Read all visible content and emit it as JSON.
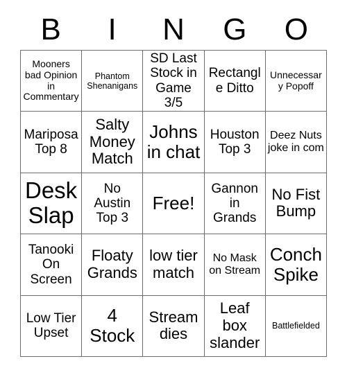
{
  "header": {
    "letters": [
      "B",
      "I",
      "N",
      "G",
      "O"
    ]
  },
  "grid": {
    "rows": 5,
    "columns": 5,
    "border_color": "#6e6e6e",
    "background": "#ffffff",
    "text_color": "#000000"
  },
  "cells": [
    {
      "text": "Mooners bad Opinion in Commentary",
      "size": "fs-xs"
    },
    {
      "text": "Phantom Shenanigans",
      "size": "fs-xxs"
    },
    {
      "text": "SD Last Stock in Game 3/5",
      "size": "fs-m"
    },
    {
      "text": "Rectangle Ditto",
      "size": "fs-m"
    },
    {
      "text": "Unnecessary Popoff",
      "size": "fs-xs"
    },
    {
      "text": "Mariposa Top 8",
      "size": "fs-m"
    },
    {
      "text": "Salty Money Match",
      "size": "fs-l"
    },
    {
      "text": "Johns in chat",
      "size": "fs-xl"
    },
    {
      "text": "Houston Top 3",
      "size": "fs-m"
    },
    {
      "text": "Deez Nuts joke in com",
      "size": "fs-s"
    },
    {
      "text": "Desk Slap",
      "size": "fs-xxl"
    },
    {
      "text": "No Austin Top 3",
      "size": "fs-m"
    },
    {
      "text": "Free!",
      "size": "fs-xl"
    },
    {
      "text": "Gannon in Grands",
      "size": "fs-m"
    },
    {
      "text": "No Fist Bump",
      "size": "fs-l"
    },
    {
      "text": "Tanooki On Screen",
      "size": "fs-m"
    },
    {
      "text": "Floaty Grands",
      "size": "fs-l"
    },
    {
      "text": "low tier match",
      "size": "fs-l"
    },
    {
      "text": "No Mask on Stream",
      "size": "fs-s"
    },
    {
      "text": "Conch Spike",
      "size": "fs-xl"
    },
    {
      "text": "Low Tier Upset",
      "size": "fs-m"
    },
    {
      "text": "4 Stock",
      "size": "fs-xl"
    },
    {
      "text": "Stream dies",
      "size": "fs-l"
    },
    {
      "text": "Leaf box slander",
      "size": "fs-l"
    },
    {
      "text": "Battlefielded",
      "size": "fs-xxs"
    }
  ]
}
